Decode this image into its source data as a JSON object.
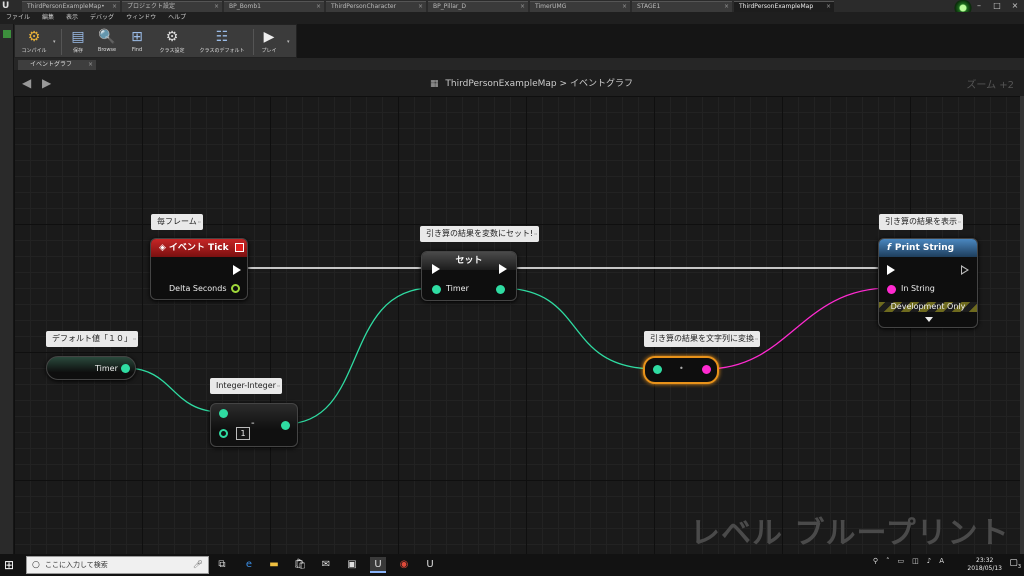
{
  "window": {
    "tabs": [
      {
        "label": "ThirdPersonExampleMap•"
      },
      {
        "label": "プロジェクト設定"
      },
      {
        "label": "BP_Bomb1"
      },
      {
        "label": "ThirdPersonCharacter"
      },
      {
        "label": "BP_Pillar_D"
      },
      {
        "label": "TimerUMG"
      },
      {
        "label": "STAGE1"
      },
      {
        "label": "ThirdPersonExampleMap"
      }
    ]
  },
  "menu": [
    "ファイル",
    "編集",
    "表示",
    "デバッグ",
    "ウィンドウ",
    "ヘルプ"
  ],
  "toolbar": {
    "compile": "コンパイル",
    "save": "保存",
    "browse": "Browse",
    "find": "Find",
    "class_settings": "クラス設定",
    "class_defaults": "クラスのデフォルト",
    "play": "プレイ"
  },
  "graph": {
    "tab_label": "イベントグラフ",
    "breadcrumb_map": "ThirdPersonExampleMap",
    "breadcrumb_sep": ">",
    "breadcrumb_graph": "イベントグラフ",
    "zoom": "ズーム +2",
    "watermark": "レベル ブループリント"
  },
  "nodes": {
    "event_tick": {
      "comment": "毎フレーム",
      "title": "イベント Tick",
      "pin": "Delta Seconds"
    },
    "timer_var": {
      "comment": "デフォルト値「１０」",
      "pin": "Timer"
    },
    "subtract": {
      "comment": "Integer-Integer",
      "operator": "-",
      "value": "1"
    },
    "set": {
      "comment": "引き算の結果を変数にセット!",
      "title": "セット",
      "pin": "Timer"
    },
    "convert": {
      "comment": "引き算の結果を文字列に変換"
    },
    "print": {
      "comment": "引き算の結果を表示",
      "title": "Print String",
      "pin": "In String",
      "dev_only": "Development Only"
    }
  },
  "taskbar": {
    "search_placeholder": "ここに入力して検索",
    "time": "23:32",
    "date": "2018/05/13",
    "notifications": "3"
  },
  "colors": {
    "event_header": "#b01c1c",
    "function_header": "#3a6ea0",
    "exec_wire": "#ffffff",
    "int_wire": "#2fdca2",
    "string_wire": "#ff2ad0"
  }
}
